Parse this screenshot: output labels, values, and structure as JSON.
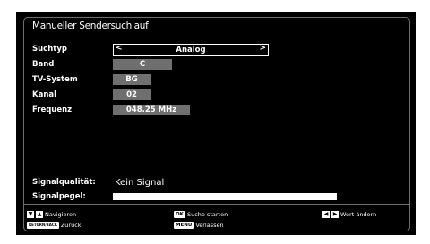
{
  "title": "Manueller Sendersuchlauf",
  "fields": [
    {
      "label": "Suchtyp",
      "value": "Analog"
    },
    {
      "label": "Band",
      "value": "C"
    },
    {
      "label": "TV-System",
      "value": "BG"
    },
    {
      "label": "Kanal",
      "value": "02"
    },
    {
      "label": "Frequenz",
      "value": "048.25 MHz"
    }
  ],
  "signal": {
    "quality_label": "Signalqualität:",
    "quality_value": "Kein Signal",
    "level_label": "Signalpegel:",
    "level": 1.0
  },
  "footer": {
    "navigate": "Navigieren",
    "back_key": "RETURN/BACK",
    "back": "Zurück",
    "ok_key": "OK",
    "start": "Suche starten",
    "menu_key": "MENU",
    "exit": "Verlassen",
    "change": "Wert ändern"
  }
}
